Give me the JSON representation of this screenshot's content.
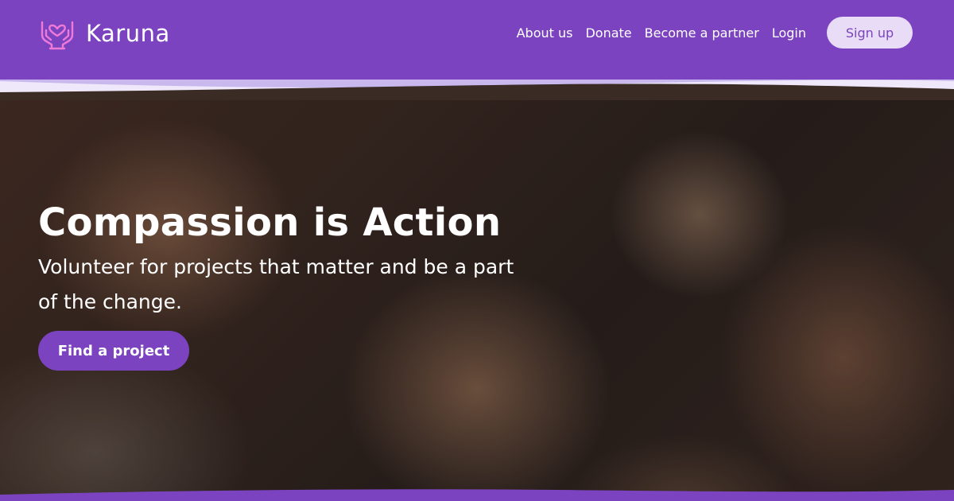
{
  "header": {
    "brand_name": "Karuna",
    "logo_icon": "heart-hands-icon",
    "nav": [
      {
        "label": "About us"
      },
      {
        "label": "Donate"
      },
      {
        "label": "Become a partner"
      },
      {
        "label": "Login"
      }
    ],
    "signup_label": "Sign up"
  },
  "hero": {
    "title": "Compassion is Action",
    "subtitle": "Volunteer for projects that matter and be a part of the change.",
    "cta_label": "Find a project",
    "image": "photo-of-smiling-children"
  },
  "colors": {
    "brand_purple": "#7b43bf",
    "signup_bg": "#e8dcf6",
    "logo_pink": "#f07ad8",
    "wave_light": "#c9b8ee",
    "text_white": "#ffffff"
  }
}
